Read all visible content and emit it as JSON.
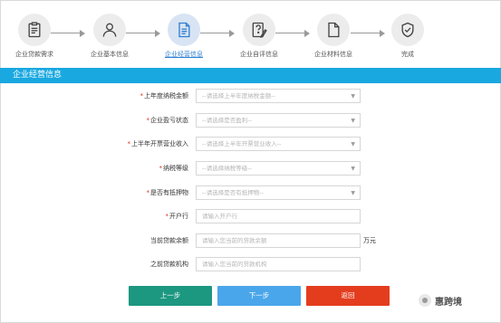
{
  "steps": [
    {
      "label": "企业贷款需求",
      "icon": "clipboard-icon"
    },
    {
      "label": "企业基本信息",
      "icon": "user-icon"
    },
    {
      "label": "企业经营信息",
      "icon": "document-icon",
      "active": true
    },
    {
      "label": "企业自评信息",
      "icon": "question-edit-icon"
    },
    {
      "label": "企业材料信息",
      "icon": "file-icon"
    },
    {
      "label": "完成",
      "icon": "shield-check-icon"
    }
  ],
  "section": {
    "title": "企业经营信息"
  },
  "form": {
    "rows": [
      {
        "label": "上年度纳税金额",
        "required": true,
        "type": "select",
        "placeholder": "--请选择上半年度纳税金额--"
      },
      {
        "label": "企业盈亏状态",
        "required": true,
        "type": "select",
        "placeholder": "--请选择是否盈利--"
      },
      {
        "label": "上半年开票营业收入",
        "required": true,
        "type": "select",
        "placeholder": "--请选择上半年开票营业收入--"
      },
      {
        "label": "纳税等级",
        "required": true,
        "type": "select",
        "placeholder": "--请选择纳税等级--"
      },
      {
        "label": "是否有抵押物",
        "required": true,
        "type": "select",
        "placeholder": "--请选择是否有抵押物--"
      },
      {
        "label": "开户行",
        "required": true,
        "type": "input",
        "placeholder": "请输入开户行"
      },
      {
        "label": "当前贷款余额",
        "required": false,
        "type": "input",
        "placeholder": "请输入您当前的贷款余额",
        "unit": "万元"
      },
      {
        "label": "之前贷款机构",
        "required": false,
        "type": "input",
        "placeholder": "请输入您当前的贷款机构"
      }
    ]
  },
  "buttons": {
    "prev": "上一步",
    "next": "下一步",
    "back": "返回"
  },
  "watermark": {
    "text": "惠跨境"
  },
  "colors": {
    "section_bar": "#19a8e0",
    "active_step": "#2f7fd1",
    "prev_button": "#1c9780",
    "next_button": "#4aa6ea",
    "back_button": "#e43d1e",
    "required_star": "#e0311c"
  }
}
